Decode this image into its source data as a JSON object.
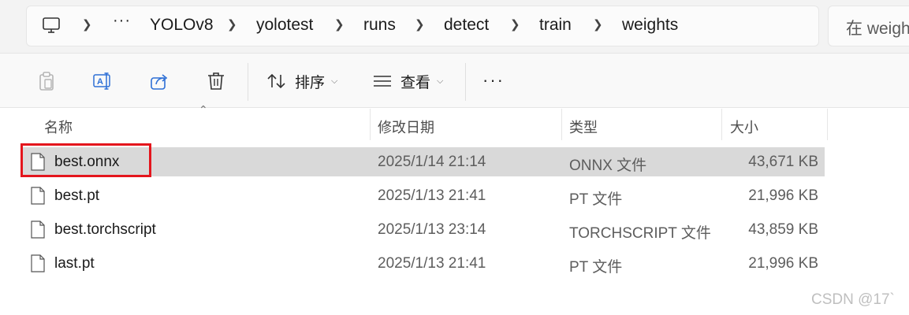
{
  "breadcrumbs": {
    "more": "···",
    "items": [
      "YOLOv8",
      "yolotest",
      "runs",
      "detect",
      "train",
      "weights"
    ]
  },
  "search": {
    "placeholder": "在 weigh"
  },
  "toolbar": {
    "sort_label": "排序",
    "view_label": "查看",
    "more_label": "···"
  },
  "columns": {
    "name": "名称",
    "date": "修改日期",
    "type": "类型",
    "size": "大小"
  },
  "files": [
    {
      "name": "best.onnx",
      "date": "2025/1/14 21:14",
      "type": "ONNX 文件",
      "size": "43,671 KB",
      "selected": true
    },
    {
      "name": "best.pt",
      "date": "2025/1/13 21:41",
      "type": "PT 文件",
      "size": "21,996 KB",
      "selected": false
    },
    {
      "name": "best.torchscript",
      "date": "2025/1/13 23:14",
      "type": "TORCHSCRIPT 文件",
      "size": "43,859 KB",
      "selected": false
    },
    {
      "name": "last.pt",
      "date": "2025/1/13 21:41",
      "type": "PT 文件",
      "size": "21,996 KB",
      "selected": false
    }
  ],
  "watermark": "CSDN @17`",
  "colors": {
    "selection": "#d9d9d9",
    "annotation_box": "#e4161d"
  }
}
